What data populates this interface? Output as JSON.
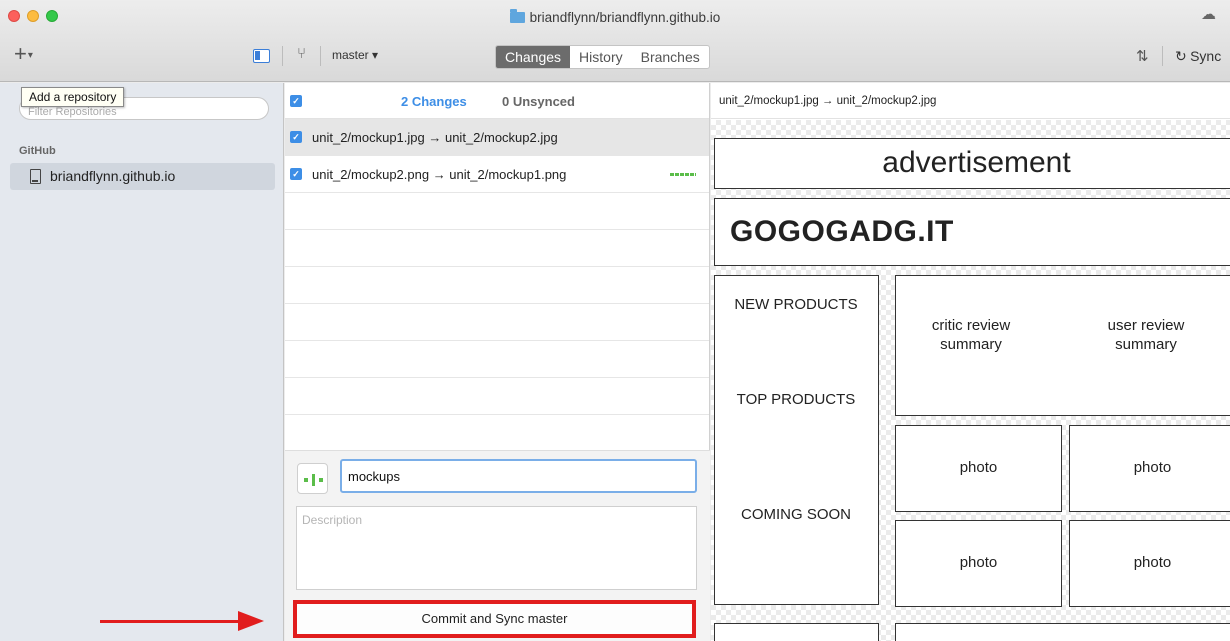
{
  "window": {
    "title": "briandflynn/briandflynn.github.io"
  },
  "toolbar": {
    "branch": "master ▾",
    "tabs": [
      "Changes",
      "History",
      "Branches"
    ],
    "sync_label": "Sync"
  },
  "sidebar": {
    "tooltip": "Add a repository",
    "filter_placeholder": "Filter Repositories",
    "section_header": "GitHub",
    "repo_name": "briandflynn.github.io"
  },
  "changes": {
    "count_label": "2 Changes",
    "unsynced_label": "0 Unsynced",
    "files": [
      {
        "name": "unit_2/mockup1.jpg → unit_2/mockup2.jpg"
      },
      {
        "name": "unit_2/mockup2.png → unit_2/mockup1.png"
      }
    ]
  },
  "commit": {
    "summary_value": "mockups",
    "description_placeholder": "Description",
    "button_label": "Commit and Sync master"
  },
  "diff": {
    "header": "unit_2/mockup1.jpg → unit_2/mockup2.jpg",
    "mockup": {
      "advertisement": "advertisement",
      "logo": "GOGOGADG.IT",
      "nav": [
        "NEW PRODUCTS",
        "TOP PRODUCTS",
        "COMING SOON"
      ],
      "reviews": [
        "critic review summary",
        "user review summary"
      ],
      "photos": [
        "photo",
        "photo",
        "photo",
        "photo"
      ]
    }
  },
  "colors": {
    "accent": "#3d8ee6",
    "annotation_red": "#e11d1d",
    "diff_added": "#5bbd4a"
  }
}
